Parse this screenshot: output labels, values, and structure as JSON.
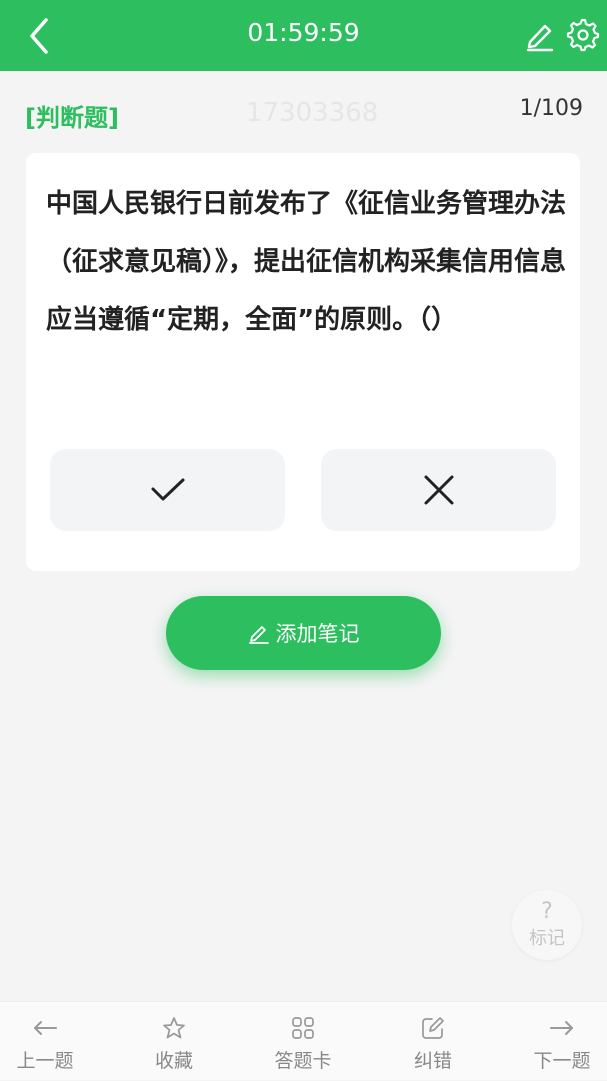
{
  "header": {
    "timer": "01:59:59"
  },
  "question": {
    "type_label": "[判断题]",
    "watermark": "17303368",
    "progress": "1/109",
    "text": "中国人民银行日前发布了《征信业务管理办法（征求意见稿）》，提出征信机构采集信用信息应当遵循“定期，全面”的原则。（）"
  },
  "actions": {
    "add_note_label": "添加笔记",
    "mark_symbol": "?",
    "mark_label": "标记"
  },
  "bottom_nav": {
    "prev": "上一题",
    "favorite": "收藏",
    "answer_card": "答题卡",
    "correction": "纠错",
    "next": "下一题"
  },
  "colors": {
    "brand_green": "#2dbf5f",
    "background": "#f4f4f4"
  },
  "icons": [
    "back-icon",
    "pencil-icon",
    "gear-icon",
    "check-icon",
    "cross-icon",
    "star-icon",
    "grid-icon",
    "edit-square-icon",
    "arrow-left-icon",
    "arrow-right-icon"
  ]
}
